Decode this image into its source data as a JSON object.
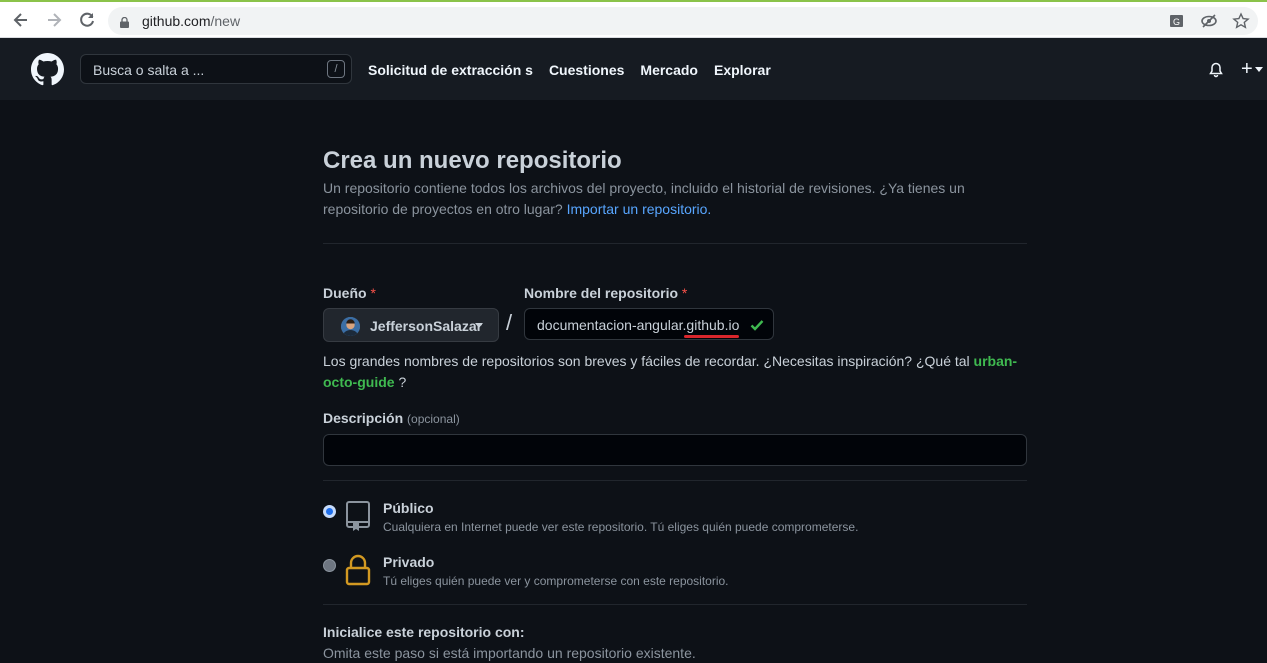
{
  "browser": {
    "url_host": "github.com",
    "url_path": "/new",
    "icons": [
      "back-icon",
      "forward-icon",
      "reload-icon",
      "lock-icon",
      "translate-icon",
      "eye-off-icon",
      "star-icon"
    ]
  },
  "header": {
    "search_placeholder": "Busca o salta a ...",
    "search_shortcut": "/",
    "nav": [
      "Solicitud de extracción s",
      "Cuestiones",
      "Mercado",
      "Explorar"
    ],
    "plus_label": "+"
  },
  "page": {
    "title": "Crea un nuevo repositorio",
    "subtitle_text": "Un repositorio contiene todos los archivos del proyecto, incluido el historial de revisiones. ¿Ya tienes un repositorio de proyectos en otro lugar?",
    "subtitle_link": "Importar un repositorio."
  },
  "form": {
    "owner_label": "Dueño",
    "required_mark": "*",
    "owner_value": "JeffersonSalazar",
    "separator": "/",
    "repo_label": "Nombre del repositorio",
    "repo_value": "documentacion-angular.github.io",
    "hint_text": "Los grandes nombres de repositorios son breves y fáciles de recordar. ¿Necesitas inspiración? ¿Qué tal",
    "hint_suggestion": "urban-octo-guide",
    "hint_end": "?",
    "description_label": "Descripción",
    "description_optional": "(opcional)",
    "description_value": ""
  },
  "visibility": {
    "public_title": "Público",
    "public_desc": "Cualquiera en Internet puede ver este repositorio. Tú eliges quién puede comprometerse.",
    "public_selected": true,
    "private_title": "Privado",
    "private_desc": "Tú eliges quién puede ver y comprometerse con este repositorio.",
    "private_selected": false
  },
  "init": {
    "title": "Inicialice este repositorio con:",
    "desc": "Omita este paso si está importando un repositorio existente."
  },
  "colors": {
    "accent_link": "#58a6ff",
    "suggestion_green": "#3fb950",
    "required_red": "#f85149",
    "lock_gold": "#d29922"
  }
}
